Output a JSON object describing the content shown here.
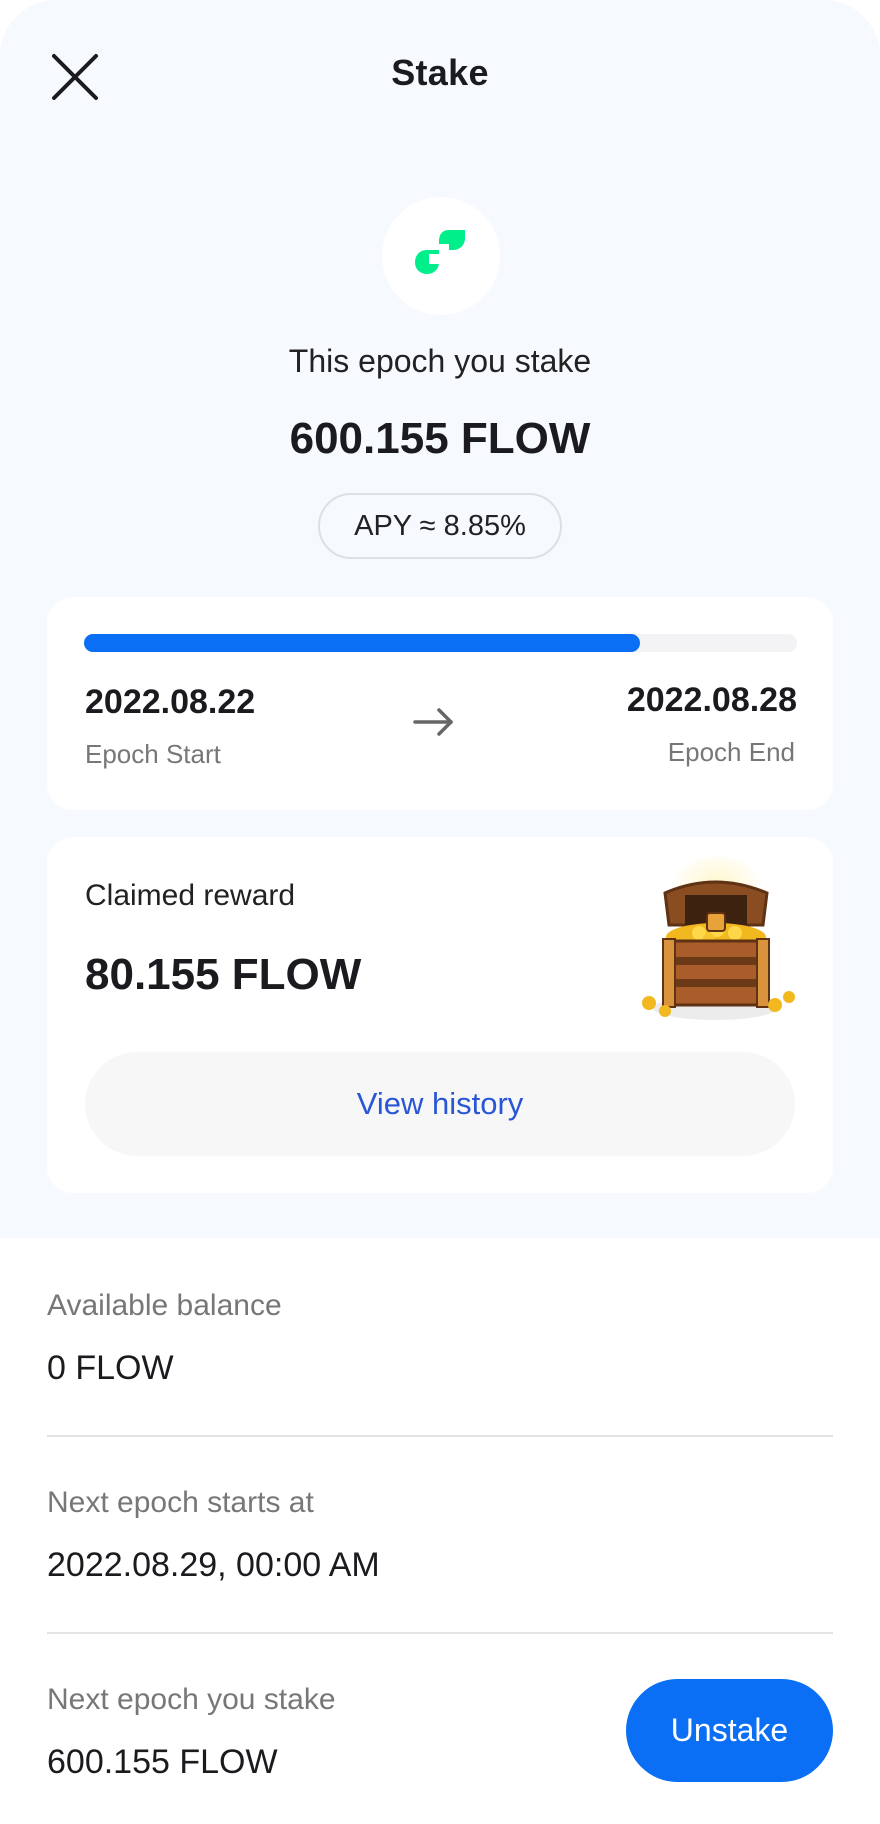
{
  "header": {
    "title": "Stake",
    "close_icon": "close-icon"
  },
  "hero": {
    "logo_icon": "flow-logo-icon",
    "epoch_label": "This epoch you stake",
    "stake_amount": "600.155 FLOW",
    "apy": "APY ≈ 8.85%"
  },
  "epoch": {
    "progress": 0.78,
    "start_date": "2022.08.22",
    "start_label": "Epoch Start",
    "end_date": "2022.08.28",
    "end_label": "Epoch End",
    "arrow_icon": "arrow-right-icon"
  },
  "reward": {
    "label": "Claimed reward",
    "amount": "80.155 FLOW",
    "illustration": "treasure-chest-icon",
    "history_button": "View history"
  },
  "details": {
    "available_label": "Available balance",
    "available_value": "0 FLOW",
    "next_epoch_label": "Next epoch starts at",
    "next_epoch_value": "2022.08.29, 00:00 AM",
    "next_stake_label": "Next epoch you stake",
    "next_stake_value": "600.155 FLOW",
    "unstake_button": "Unstake"
  },
  "colors": {
    "accent": "#0a6ff5",
    "link": "#2a56d6",
    "flow_green": "#00ef8b",
    "top_background": "#f6f9fe"
  }
}
